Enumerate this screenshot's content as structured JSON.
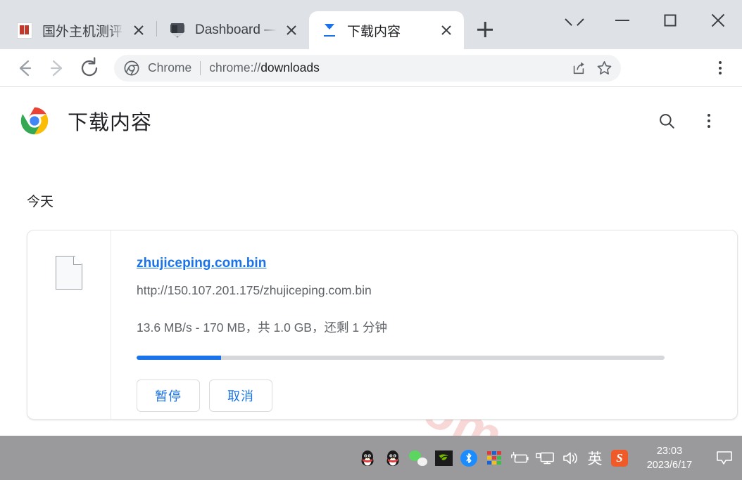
{
  "window": {
    "tabs": [
      {
        "title": "国外主机测评",
        "favicon": "red-seal-favicon",
        "active": false,
        "close_label": "×"
      },
      {
        "title": "Dashboard —",
        "favicon": "shield-favicon",
        "active": false,
        "close_label": "×"
      },
      {
        "title": "下载内容",
        "favicon": "download-favicon",
        "active": true,
        "close_label": "×"
      }
    ],
    "new_tab_icon": "plus-icon",
    "controls": [
      {
        "name": "tab-search",
        "icon": "chevron-down-icon"
      },
      {
        "name": "minimize",
        "icon": "minimize-icon"
      },
      {
        "name": "maximize",
        "icon": "maximize-icon"
      },
      {
        "name": "close",
        "icon": "close-icon"
      }
    ]
  },
  "toolbar": {
    "back_icon": "arrow-left-icon",
    "forward_icon": "arrow-right-icon",
    "reload_icon": "reload-icon",
    "omnibox": {
      "site_icon": "chrome-icon",
      "site_label": "Chrome",
      "url_scheme": "chrome://",
      "url_path": "downloads",
      "url_full": "chrome://downloads",
      "share_icon": "share-icon",
      "bookmark_icon": "star-icon"
    },
    "menu_icon": "more-vertical-icon"
  },
  "page": {
    "logo": "chrome-logo",
    "title": "下载内容",
    "search_icon": "search-icon",
    "menu_icon": "more-vertical-icon",
    "watermark": "zhujiceping.com",
    "watermark_color": "#f8d7d7",
    "section_label": "今天",
    "downloads": [
      {
        "file_icon": "generic-file-icon",
        "file_name": "zhujiceping.com.bin",
        "file_url": "http://150.107.201.175/zhujiceping.com.bin",
        "status": "13.6 MB/s - 170 MB，共 1.0 GB，还剩 1 分钟",
        "progress_percent": 16,
        "accent_color": "#1a73e8",
        "buttons": [
          {
            "label": "暂停",
            "name": "pause-button"
          },
          {
            "label": "取消",
            "name": "cancel-button"
          }
        ]
      }
    ]
  },
  "taskbar": {
    "tray_icons": [
      "qq-penguin-icon",
      "qq-penguin-icon",
      "wechat-icon",
      "nvidia-icon",
      "bluetooth-icon",
      "color-grid-icon",
      "battery-icon",
      "display-icon",
      "volume-icon"
    ],
    "ime_label": "英",
    "sogou_label": "S",
    "clock_time": "23:03",
    "clock_date": "2023/6/17",
    "notification_icon": "speech-bubble-icon"
  }
}
